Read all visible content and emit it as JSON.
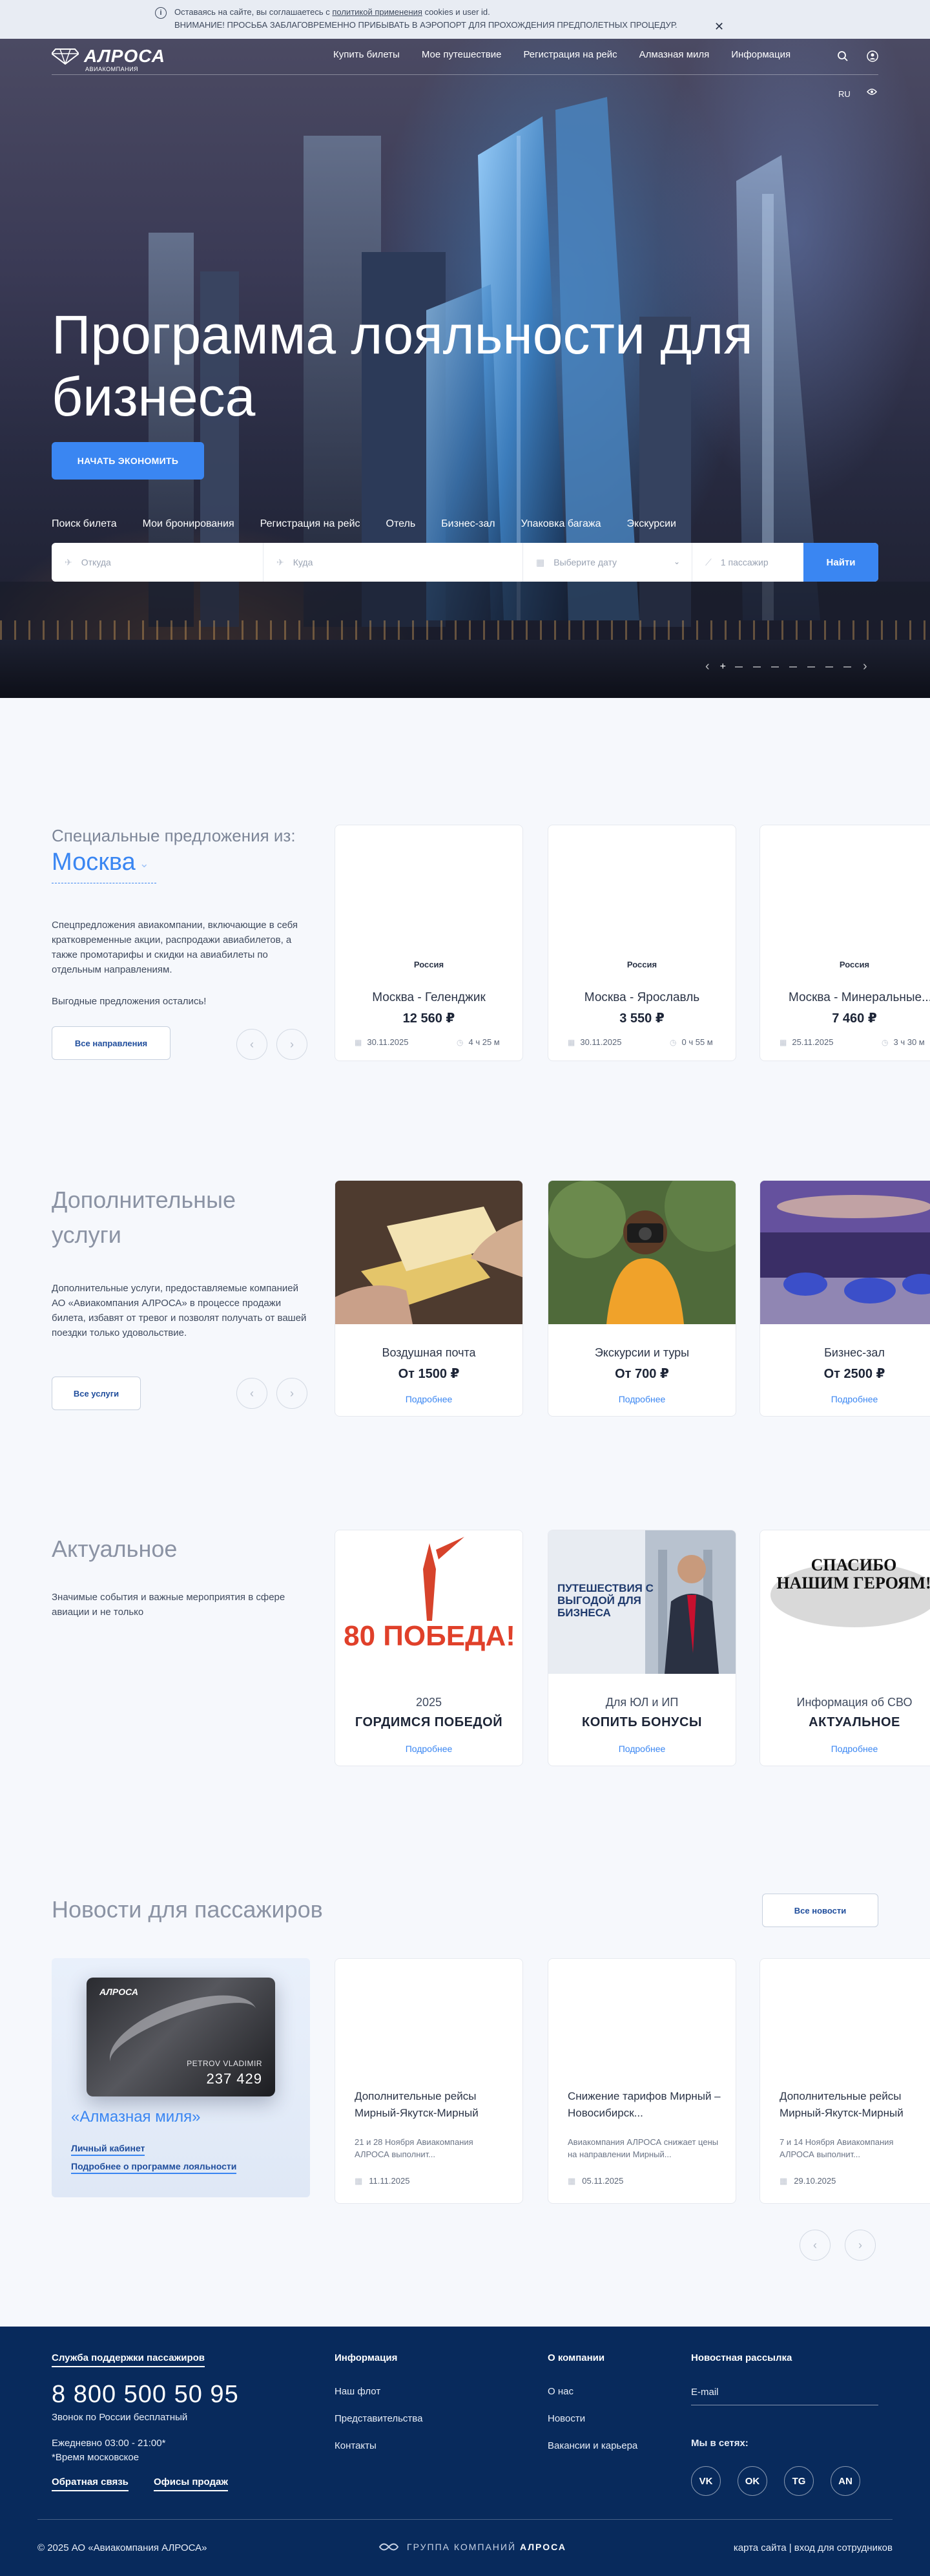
{
  "notice": {
    "line1_prefix": "Оставаясь на сайте, вы соглашаетесь с",
    "line1_link": "политикой применения",
    "line1_suffix": "cookies и user id.",
    "line2": "ВНИМАНИЕ! ПРОСЬБА ЗАБЛАГОВРЕМЕННО ПРИБЫВАТЬ В АЭРОПОРТ ДЛЯ ПРОХОЖДЕНИЯ ПРЕДПОЛЕТНЫХ ПРОЦЕДУР.",
    "close": "✕"
  },
  "header": {
    "logo": "АЛРОСА",
    "logo_sub": "АВИАКОМПАНИЯ",
    "menu": [
      "Купить билеты",
      "Мое путешествие",
      "Регистрация на рейс",
      "Алмазная миля",
      "Информация"
    ],
    "lang": "RU"
  },
  "hero": {
    "title": "Программа лояльности для бизнеса",
    "cta": "НАЧАТЬ ЭКОНОМИТЬ",
    "tabs": [
      "Поиск билета",
      "Мои бронирования",
      "Регистрация на рейс",
      "Отель",
      "Бизнес-зал",
      "Упаковка багажа",
      "Экскурсии"
    ],
    "from_placeholder": "Откуда",
    "to_placeholder": "Куда",
    "date_placeholder": "Выберите дату",
    "pax": "1 пассажир",
    "search_button": "Найти",
    "slider_prev": "‹",
    "slider_next": "›"
  },
  "offers": {
    "label": "Специальные предложения из:",
    "city": "Москва",
    "desc": "Спецпредложения авиакомпании, включающие в себя кратковременные акции, распродажи авиабилетов, а также промотарифы и скидки на авиабилеты по отдельным направлениям.",
    "desc2": "Выгодные предложения остались!",
    "all_button": "Все направления",
    "items": [
      {
        "country": "Россия",
        "route": "Москва - Геленджик",
        "price": "12 560 ₽",
        "date": "30.11.2025",
        "duration": "4 ч 25 м"
      },
      {
        "country": "Россия",
        "route": "Москва - Ярославль",
        "price": "3 550 ₽",
        "date": "30.11.2025",
        "duration": "0 ч 55 м"
      },
      {
        "country": "Россия",
        "route": "Москва - Минеральные...",
        "price": "7 460 ₽",
        "date": "25.11.2025",
        "duration": "3 ч 30 м"
      }
    ]
  },
  "services": {
    "title": "Дополнительные услуги",
    "desc": "Дополнительные услуги, предоставляемые компанией АО «Авиакомпания АЛРОСА» в процессе продажи билета, избавят от тревог и позволят получать от вашей поездки только удовольствие.",
    "all_button": "Все услуги",
    "more": "Подробнее",
    "items": [
      {
        "name": "Воздушная почта",
        "price": "От 1500 ₽"
      },
      {
        "name": "Экскурсии и туры",
        "price": "От 700 ₽"
      },
      {
        "name": "Бизнес-зал",
        "price": "От 2500 ₽"
      }
    ]
  },
  "actual": {
    "title": "Актуальное",
    "desc": "Значимые события и важные мероприятия в сфере авиации и не только",
    "more": "Подробнее",
    "items": [
      {
        "small": "2025",
        "big": "ГОРДИМСЯ ПОБЕДОЙ",
        "img_text": "80 ПОБЕДА!"
      },
      {
        "small": "Для ЮЛ и ИП",
        "big": "КОПИТЬ БОНУСЫ",
        "img_text": "ПУТЕШЕСТВИЯ С ВЫГОДОЙ ДЛЯ БИЗНЕСА"
      },
      {
        "small": "Информация об СВО",
        "big": "АКТУАЛЬНОЕ",
        "img_text": "СПАСИБО НАШИМ ГЕРОЯМ!"
      }
    ]
  },
  "news": {
    "title": "Новости для пассажиров",
    "all_button": "Все новости",
    "promo": {
      "card_brand": "АЛРОСА",
      "card_holder": "PETROV VLADIMIR",
      "card_number": "237 429",
      "title": "«Алмазная миля»",
      "link1": "Личный кабинет",
      "link2": "Подробнее о программе лояльности"
    },
    "items": [
      {
        "title": "Дополнительные рейсы Мирный-Якутск-Мирный",
        "text": "21 и 28 Ноября Авиакомпания АЛРОСА выполнит...",
        "date": "11.11.2025"
      },
      {
        "title": "Снижение тарифов Мирный – Новосибирск...",
        "text": "Авиакомпания АЛРОСА снижает цены на направлении Мирный...",
        "date": "05.11.2025"
      },
      {
        "title": "Дополнительные рейсы Мирный-Якутск-Мирный",
        "text": "7 и 14 Ноября Авиакомпания АЛРОСА выполнит...",
        "date": "29.10.2025"
      }
    ]
  },
  "footer": {
    "support_title": "Служба поддержки пассажиров",
    "phone": "8 800 500 50 95",
    "phone_note": "Звонок по России бесплатный",
    "hours": "Ежедневно 03:00 - 21:00*",
    "hours_note": "*Время московское",
    "feedback": "Обратная связь",
    "sales_offices": "Офисы продаж",
    "info_title": "Информация",
    "info_links": [
      "Наш флот",
      "Представительства",
      "Контакты"
    ],
    "company_title": "О компании",
    "company_links": [
      "О нас",
      "Новости",
      "Вакансии и карьера"
    ],
    "newsletter_title": "Новостная рассылка",
    "email_placeholder": "E-mail",
    "social_title": "Мы в сетях:",
    "social": [
      "VK",
      "OK",
      "TG",
      "AN"
    ],
    "copyright": "© 2025 АО «Авиакомпания АЛРОСА»",
    "group_prefix": "ГРУППА КОМПАНИЙ",
    "group_name": "АЛРОСА",
    "bottom_right": "карта сайта | вход для сотрудников"
  }
}
